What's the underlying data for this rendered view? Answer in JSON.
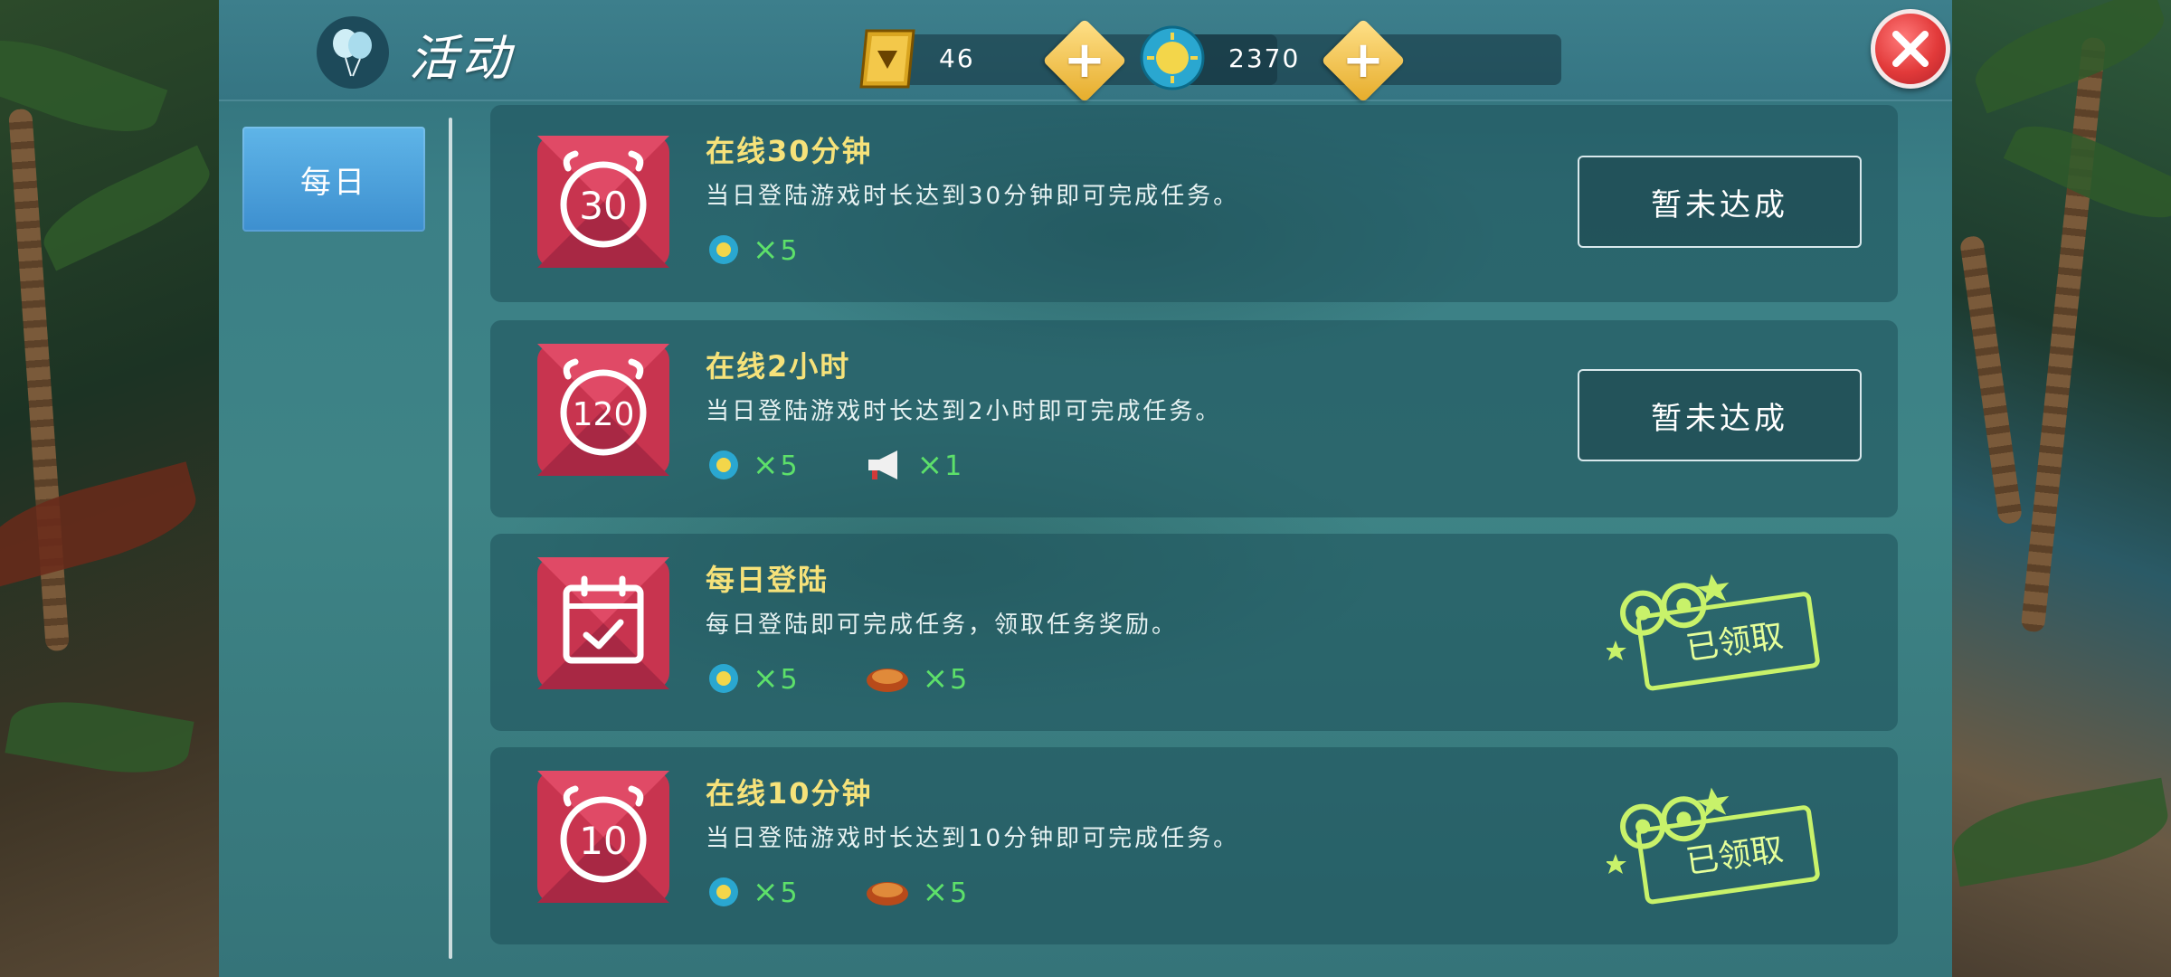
{
  "header": {
    "title": "活动",
    "gems": "46",
    "coins": "2370"
  },
  "sidebar": {
    "tabs": [
      {
        "label": "每日"
      }
    ]
  },
  "tasks": [
    {
      "icon_label": "30",
      "icon": "alarm-clock-icon",
      "title": "在线30分钟",
      "description": "当日登陆游戏时长达到30分钟即可完成任务。",
      "rewards": [
        {
          "icon": "coin-icon",
          "count": "5"
        }
      ],
      "status": "暂未达成",
      "claimed": false
    },
    {
      "icon_label": "120",
      "icon": "alarm-clock-icon",
      "title": "在线2小时",
      "description": "当日登陆游戏时长达到2小时即可完成任务。",
      "rewards": [
        {
          "icon": "coin-icon",
          "count": "5"
        },
        {
          "icon": "megaphone-icon",
          "count": "1"
        }
      ],
      "status": "暂未达成",
      "claimed": false
    },
    {
      "icon_label": "",
      "icon": "calendar-check-icon",
      "title": "每日登陆",
      "description": "每日登陆即可完成任务，领取任务奖励。",
      "rewards": [
        {
          "icon": "coin-icon",
          "count": "5"
        },
        {
          "icon": "food-icon",
          "count": "5"
        }
      ],
      "status": "已领取",
      "claimed": true
    },
    {
      "icon_label": "10",
      "icon": "alarm-clock-icon",
      "title": "在线10分钟",
      "description": "当日登陆游戏时长达到10分钟即可完成任务。",
      "rewards": [
        {
          "icon": "coin-icon",
          "count": "5"
        },
        {
          "icon": "food-icon",
          "count": "5"
        }
      ],
      "status": "已领取",
      "claimed": true
    }
  ],
  "colors": {
    "title_yellow": "#f6e27a",
    "reward_green": "#5de06a",
    "icon_red": "#d23a58",
    "stamp_green": "#c8f26a"
  }
}
